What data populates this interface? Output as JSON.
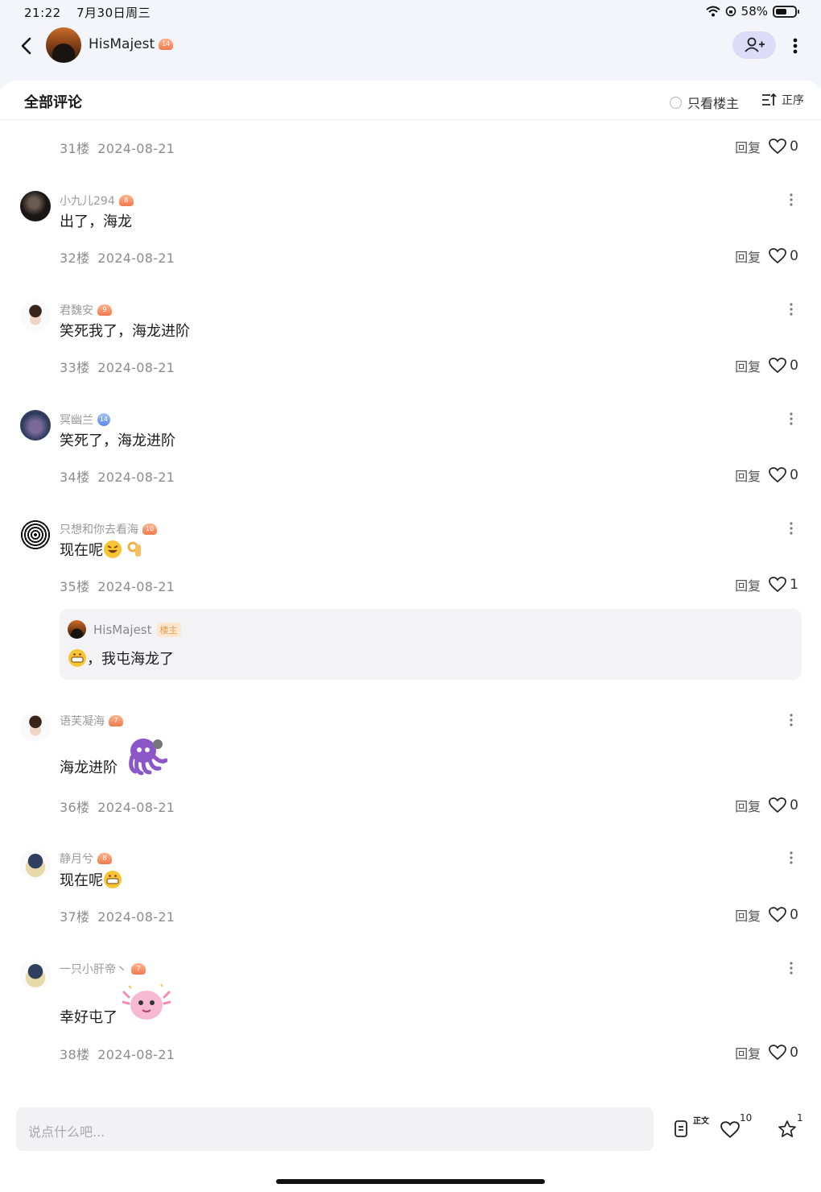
{
  "status": {
    "time": "21:22",
    "date": "7月30日周三",
    "battery": "58%",
    "battery_level": 0.58
  },
  "nav": {
    "username": "HisMajest",
    "level": "14"
  },
  "header": {
    "title": "全部评论",
    "only_op": "只看楼主",
    "sort": "正序"
  },
  "actions": {
    "reply_label": "回复"
  },
  "prev_comment": {
    "floor": "31楼",
    "date": "2024-08-21",
    "likes": "0"
  },
  "comments": [
    {
      "user": "小九儿294",
      "level": "8",
      "text": "出了，海龙",
      "floor": "32楼",
      "date": "2024-08-21",
      "likes": "0"
    },
    {
      "user": "君魏安",
      "level": "9",
      "text": "笑死我了，海龙进阶",
      "floor": "33楼",
      "date": "2024-08-21",
      "likes": "0"
    },
    {
      "user": "冥幽兰",
      "level": "14",
      "text": "笑死了，海龙进阶",
      "floor": "34楼",
      "date": "2024-08-21",
      "likes": "0"
    },
    {
      "user": "只想和你去看海",
      "level": "10",
      "text": "现在呢",
      "floor": "35楼",
      "date": "2024-08-21",
      "likes": "1",
      "reply": {
        "user": "HisMajest",
        "tag": "楼主",
        "text": "，我屯海龙了"
      }
    },
    {
      "user": "语芙凝海",
      "level": "7",
      "text": "海龙进阶",
      "floor": "36楼",
      "date": "2024-08-21",
      "likes": "0"
    },
    {
      "user": "静月兮",
      "level": "8",
      "text": "现在呢",
      "floor": "37楼",
      "date": "2024-08-21",
      "likes": "0"
    },
    {
      "user": "一只小肝帝丶",
      "level": "7",
      "text": "幸好屯了",
      "floor": "38楼",
      "date": "2024-08-21",
      "likes": "0"
    }
  ],
  "bottom": {
    "placeholder": "说点什么吧...",
    "doc_label": "正文",
    "likes": "10",
    "stars": "1"
  },
  "colors": {
    "accent_bg": "#dcdcf9",
    "badge": "#f07a50",
    "op_tag": "#e79b49",
    "text_gray": "#8c8c8c"
  },
  "icons": [
    "back-arrow-icon",
    "add-user-icon",
    "more-vertical-icon",
    "radio-icon",
    "sort-icon",
    "heart-icon",
    "document-icon",
    "star-icon",
    "wifi-icon",
    "battery-icon"
  ]
}
